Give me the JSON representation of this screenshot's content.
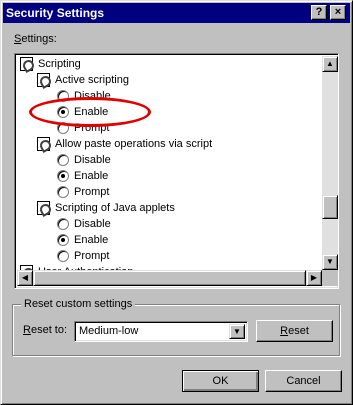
{
  "window": {
    "title": "Security Settings",
    "help_glyph": "?",
    "close_glyph": "×"
  },
  "settings_label": {
    "prefix": "",
    "mnemonic": "S",
    "rest": "ettings:"
  },
  "tree": [
    {
      "kind": "heading",
      "label": "Scripting",
      "icon": "scripting-icon"
    },
    {
      "kind": "setting",
      "label": "Active scripting",
      "icon": "setting-icon"
    },
    {
      "kind": "option",
      "label": "Disable",
      "selected": false
    },
    {
      "kind": "option",
      "label": "Enable",
      "selected": true
    },
    {
      "kind": "option",
      "label": "Prompt",
      "selected": false
    },
    {
      "kind": "setting",
      "label": "Allow paste operations via script",
      "icon": "setting-icon"
    },
    {
      "kind": "option",
      "label": "Disable",
      "selected": false
    },
    {
      "kind": "option",
      "label": "Enable",
      "selected": true
    },
    {
      "kind": "option",
      "label": "Prompt",
      "selected": false
    },
    {
      "kind": "setting",
      "label": "Scripting of Java applets",
      "icon": "setting-icon"
    },
    {
      "kind": "option",
      "label": "Disable",
      "selected": false
    },
    {
      "kind": "option",
      "label": "Enable",
      "selected": true
    },
    {
      "kind": "option",
      "label": "Prompt",
      "selected": false
    },
    {
      "kind": "heading",
      "label": "User Authentication",
      "icon": "user-auth-icon"
    }
  ],
  "scrollbars": {
    "vertical_position": 0.78,
    "up_glyph": "▲",
    "down_glyph": "▼",
    "left_glyph": "◀",
    "right_glyph": "▶"
  },
  "annotation": {
    "color": "#e00000",
    "target": "Enable"
  },
  "reset_group": {
    "title": "Reset custom settings",
    "reset_to_mnemonic": "R",
    "reset_to_rest": "eset to:",
    "selected_level": "Medium-low",
    "dropdown_glyph": "▼",
    "reset_button_mnemonic": "R",
    "reset_button_rest": "eset"
  },
  "buttons": {
    "ok": "OK",
    "cancel": "Cancel"
  },
  "colors": {
    "titlebar": "#000080",
    "face": "#c0c0c0"
  }
}
